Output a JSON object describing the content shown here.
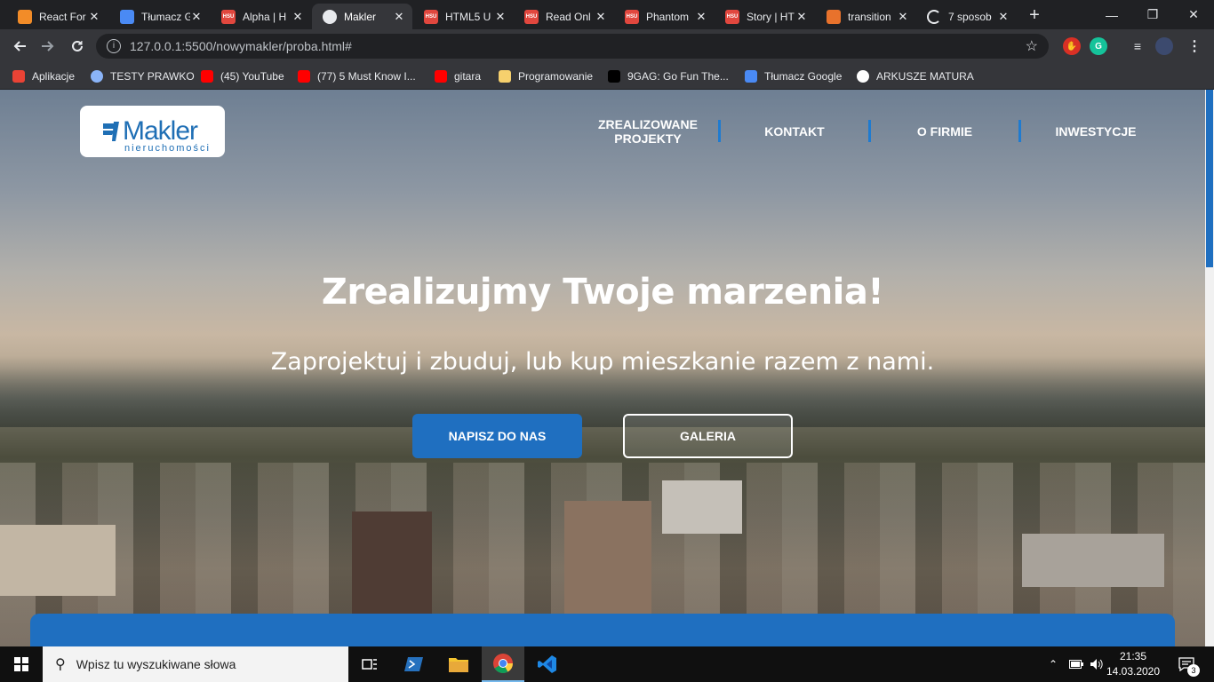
{
  "browser": {
    "tabs": [
      {
        "title": "React For",
        "favicon": "react-favicon",
        "color": "#f28c28"
      },
      {
        "title": "Tłumacz G",
        "favicon": "google-translate-favicon",
        "color": "#4a8af4"
      },
      {
        "title": "Alpha | H",
        "favicon": "hsu-favicon",
        "color": "#e1473e"
      },
      {
        "title": "Makler",
        "favicon": "globe-favicon",
        "color": "#9aa0a6"
      },
      {
        "title": "HTML5 U",
        "favicon": "hsu-favicon",
        "color": "#e1473e"
      },
      {
        "title": "Read Onl",
        "favicon": "hsu-favicon",
        "color": "#e1473e"
      },
      {
        "title": "Phantom",
        "favicon": "hsu-favicon",
        "color": "#e1473e"
      },
      {
        "title": "Story | HT",
        "favicon": "hsu-favicon",
        "color": "#e1473e"
      },
      {
        "title": "transition",
        "favicon": "codepen-favicon",
        "color": "#e8722c"
      },
      {
        "title": "7 sposob",
        "favicon": "loading-spinner",
        "color": "#202124"
      }
    ],
    "favicon_label": "HSU",
    "close_glyph": "✕",
    "new_tab_glyph": "+",
    "window_controls": {
      "minimize": "—",
      "maximize": "❐",
      "close": "✕"
    },
    "url": "127.0.0.1:5500/nowymakler/proba.html#",
    "bookmarks": [
      {
        "label": "Aplikacje",
        "icon": "apps-icon",
        "color": "#ea4335"
      },
      {
        "label": "TESTY PRAWKO",
        "icon": "globe-bm-icon",
        "color": "#8ab4f8"
      },
      {
        "label": "(45) YouTube",
        "icon": "youtube-icon",
        "color": "#ff0000"
      },
      {
        "label": "(77) 5 Must Know I...",
        "icon": "youtube-icon",
        "color": "#ff0000"
      },
      {
        "label": "gitara",
        "icon": "youtube-icon",
        "color": "#ff0000"
      },
      {
        "label": "Programowanie",
        "icon": "folder-icon",
        "color": "#f6d06d"
      },
      {
        "label": "9GAG: Go Fun The...",
        "icon": "9gag-icon",
        "color": "#000000"
      },
      {
        "label": "Tłumacz Google",
        "icon": "google-translate-icon",
        "color": "#4a8af4"
      },
      {
        "label": "ARKUSZE MATURA",
        "icon": "globe-bm-icon",
        "color": "#ffffff"
      }
    ]
  },
  "site": {
    "logo": {
      "word": "Makler",
      "sub": "nieruchomości"
    },
    "nav": [
      {
        "label": "ZREALIZOWANE\nPROJEKTY"
      },
      {
        "label": "KONTAKT"
      },
      {
        "label": "O FIRMIE"
      },
      {
        "label": "INWESTYCJE"
      }
    ],
    "hero": {
      "title": "Zrealizujmy Twoje marzenia!",
      "subtitle": "Zaprojektuj i zbuduj, lub kup mieszkanie razem z nami.",
      "primary_button": "NAPISZ DO NAS",
      "secondary_button": "GALERIA"
    },
    "accent_color": "#1f6fc0"
  },
  "taskbar": {
    "search_placeholder": "Wpisz tu wyszukiwane słowa",
    "time": "21:35",
    "date": "14.03.2020",
    "notifications": "3"
  }
}
